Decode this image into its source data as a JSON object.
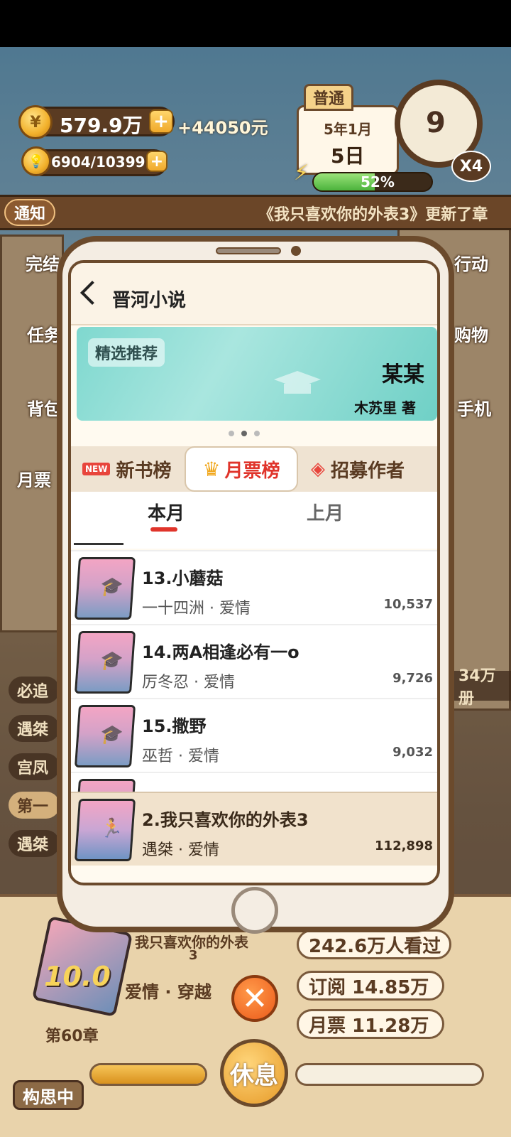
{
  "hud": {
    "money": "579.9万",
    "income": "+44050元",
    "inspiration": "6904/10399",
    "mode_tag": "普通",
    "date_month": "5年1月",
    "date_day": "5日",
    "clock_value": "9",
    "speed": "X4",
    "energy_percent": "52%",
    "energy_fraction": 0.52
  },
  "notice": {
    "tag": "通知",
    "text": "《我只喜欢你的外表3》更新了章"
  },
  "side_left": [
    "完结",
    "任务",
    "背包",
    "月票"
  ],
  "side_right": [
    "行动",
    "购物",
    "手机"
  ],
  "left_list": [
    "必追",
    "遇桀",
    "宫凤",
    "第一",
    "遇桀"
  ],
  "right_strip": "34万册",
  "phone": {
    "app_title": "晋河小说",
    "banner": {
      "tag": "精选推荐",
      "title": "某某",
      "author": "木苏里 著"
    },
    "tabs": [
      {
        "badge": "NEW",
        "label": "新书榜"
      },
      {
        "label": "月票榜"
      },
      {
        "label": "招募作者"
      }
    ],
    "subtabs": [
      "本月",
      "上月"
    ],
    "rows": [
      {
        "title": "13.小蘑菇",
        "sub": "一十四洲 · 爱情",
        "count": "10,537"
      },
      {
        "title": "14.两A相逢必有一o",
        "sub": "厉冬忍 · 爱情",
        "count": "9,726"
      },
      {
        "title": "15.撒野",
        "sub": "巫哲 · 爱情",
        "count": "9,032"
      }
    ],
    "my_book": {
      "title": "2.我只喜欢你的外表3",
      "sub": "遇桀 · 爱情",
      "count": "112,898"
    }
  },
  "bottom": {
    "book_title_1": "我只喜欢你的外表",
    "book_title_2": "3",
    "genre": "爱情 · 穿越",
    "score": "10.0",
    "chapter": "第60章",
    "views": "242.6万人看过",
    "subs": "订阅 14.85万",
    "votes": "月票 11.28万",
    "rest": "休息",
    "status": "构思中"
  }
}
